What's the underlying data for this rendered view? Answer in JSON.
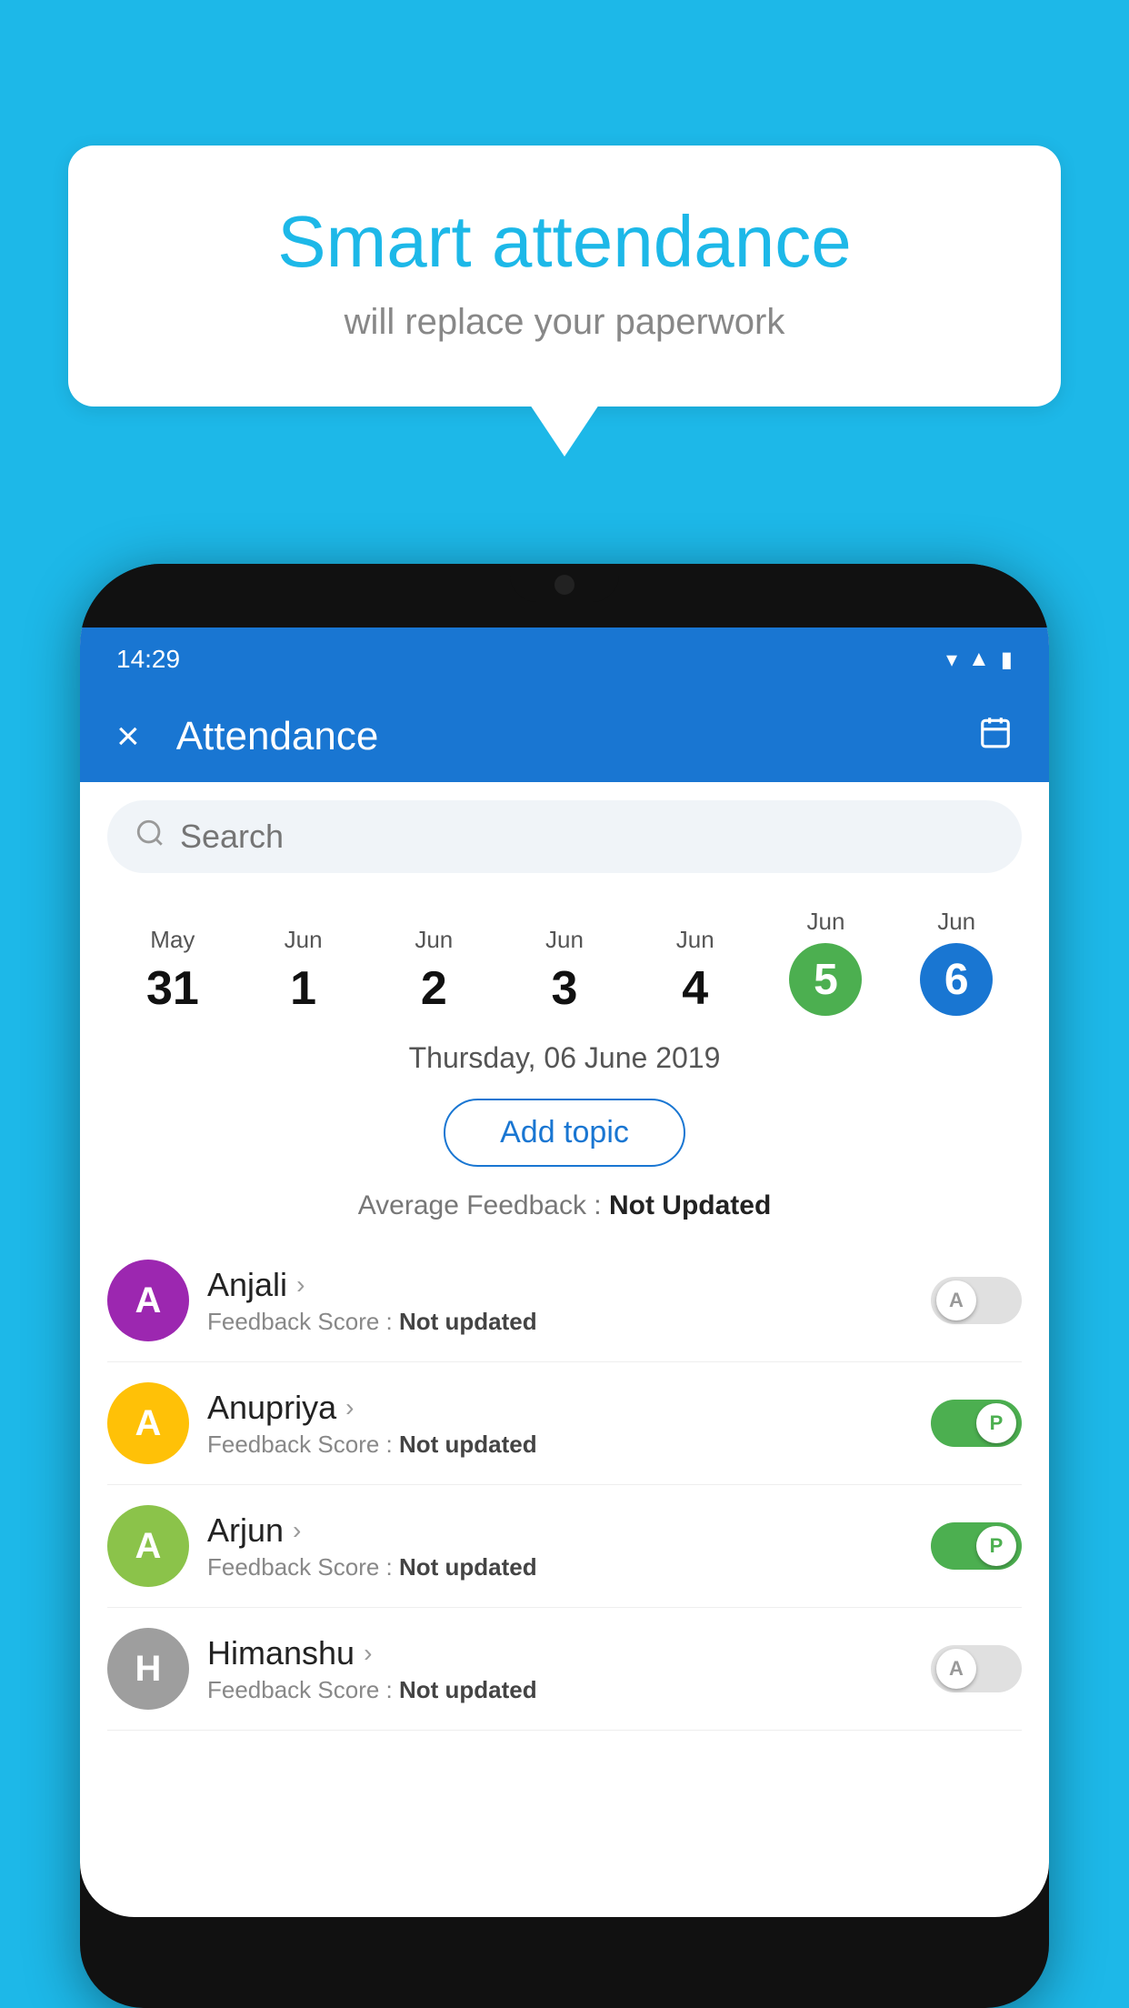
{
  "background_color": "#1DB8E8",
  "speech_bubble": {
    "title": "Smart attendance",
    "subtitle": "will replace your paperwork"
  },
  "status_bar": {
    "time": "14:29",
    "icons": [
      "wifi",
      "signal",
      "battery"
    ]
  },
  "app_header": {
    "title": "Attendance",
    "close_label": "×",
    "calendar_icon": "📅"
  },
  "search": {
    "placeholder": "Search"
  },
  "date_strip": [
    {
      "month": "May",
      "day": "31",
      "active": false
    },
    {
      "month": "Jun",
      "day": "1",
      "active": false
    },
    {
      "month": "Jun",
      "day": "2",
      "active": false
    },
    {
      "month": "Jun",
      "day": "3",
      "active": false
    },
    {
      "month": "Jun",
      "day": "4",
      "active": false
    },
    {
      "month": "Jun",
      "day": "5",
      "active": "green"
    },
    {
      "month": "Jun",
      "day": "6",
      "active": "blue"
    }
  ],
  "selected_date": "Thursday, 06 June 2019",
  "add_topic_label": "Add topic",
  "average_feedback_label": "Average Feedback :",
  "average_feedback_value": "Not Updated",
  "students": [
    {
      "name": "Anjali",
      "avatar_letter": "A",
      "avatar_color": "#9C27B0",
      "feedback_label": "Feedback Score :",
      "feedback_value": "Not updated",
      "toggle": "off",
      "toggle_letter": "A"
    },
    {
      "name": "Anupriya",
      "avatar_letter": "A",
      "avatar_color": "#FFC107",
      "feedback_label": "Feedback Score :",
      "feedback_value": "Not updated",
      "toggle": "on",
      "toggle_letter": "P"
    },
    {
      "name": "Arjun",
      "avatar_letter": "A",
      "avatar_color": "#8BC34A",
      "feedback_label": "Feedback Score :",
      "feedback_value": "Not updated",
      "toggle": "on",
      "toggle_letter": "P"
    },
    {
      "name": "Himanshu",
      "avatar_letter": "H",
      "avatar_color": "#9E9E9E",
      "feedback_label": "Feedback Score :",
      "feedback_value": "Not updated",
      "toggle": "off",
      "toggle_letter": "A"
    }
  ]
}
